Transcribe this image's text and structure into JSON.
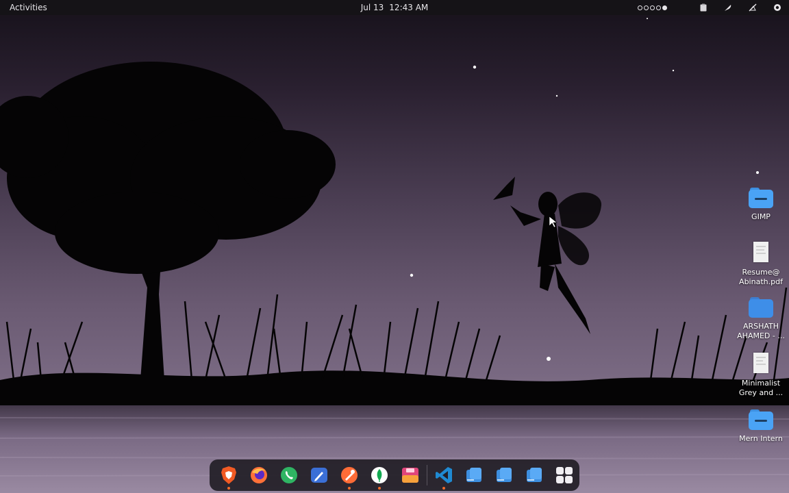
{
  "topbar": {
    "activities_label": "Activities",
    "date": "Jul 13",
    "time": "12:43 AM",
    "workspaces": 5,
    "active_workspace": 5
  },
  "desktop_icons": [
    {
      "label": "GIMP",
      "type": "folder",
      "icon": "folder-icon"
    },
    {
      "label_line1": "Resume@",
      "label_line2": "Abinath.pdf",
      "type": "document",
      "icon": "pdf-document-icon"
    },
    {
      "label_line1": "ARSHATH",
      "label_line2": "AHAMED - ...",
      "type": "document",
      "icon": "document-icon"
    },
    {
      "label_line1": "Minimalist",
      "label_line2": "Grey and ...",
      "type": "document",
      "icon": "document-icon"
    },
    {
      "label": "Mern Intern",
      "type": "folder",
      "icon": "folder-icon"
    }
  ],
  "dock": {
    "items": [
      {
        "app": "brave",
        "icon": "brave-icon",
        "running": true
      },
      {
        "app": "firefox",
        "icon": "firefox-icon",
        "running": false
      },
      {
        "app": "whatsapp",
        "icon": "whatsapp-icon",
        "running": false
      },
      {
        "app": "text-editor",
        "icon": "text-editor-icon",
        "running": false
      },
      {
        "app": "postman",
        "icon": "postman-icon",
        "running": true
      },
      {
        "app": "mongodb-compass",
        "icon": "mongodb-icon",
        "running": true
      },
      {
        "app": "image-viewer",
        "icon": "image-viewer-icon",
        "running": false
      },
      {
        "app": "vscode",
        "icon": "vscode-icon",
        "running": true
      },
      {
        "app": "files-1",
        "icon": "files-icon",
        "running": false
      },
      {
        "app": "files-2",
        "icon": "files-icon",
        "running": false
      },
      {
        "app": "files-3",
        "icon": "files-icon",
        "running": false
      },
      {
        "app": "app-grid",
        "icon": "app-grid-icon",
        "running": false
      }
    ]
  },
  "colors": {
    "topbar_bg": "#151317",
    "dock_bg": "#221e26",
    "folder_blue": "#4aa3f5",
    "running_indicator": "#f26a2a"
  }
}
